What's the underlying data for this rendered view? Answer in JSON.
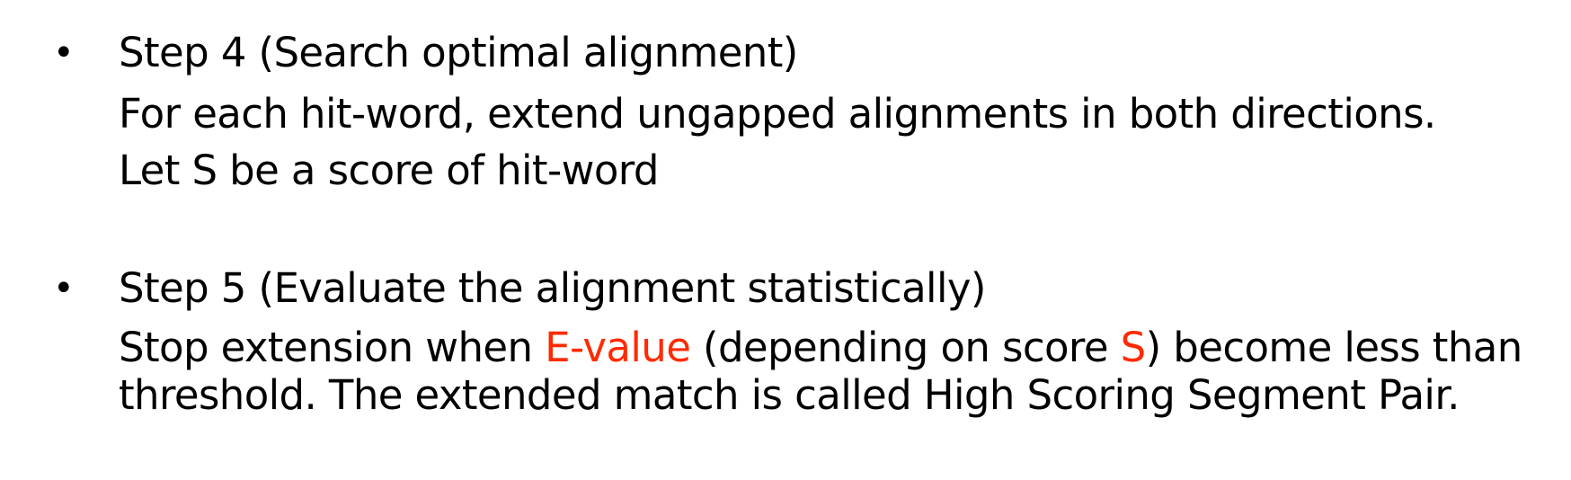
{
  "bullets": [
    {
      "symbol": "•",
      "heading": "Step 4 (Search optimal alignment)",
      "line2": "For each hit-word, extend ungapped alignments in both directions.",
      "line3": "Let S be a score of hit-word"
    },
    {
      "symbol": "•",
      "heading": "Step 5 (Evaluate the alignment statistically)",
      "line2_part1": "Stop extension when ",
      "line2_highlight1": "E-value",
      "line2_part2": " (depending on score ",
      "line2_highlight2": "S",
      "line2_part3": ") become less than",
      "line3": "threshold. The extended match is called High Scoring Segment Pair."
    }
  ],
  "colors": {
    "text": "#000000",
    "highlight": "#ff2a00",
    "background": "#ffffff"
  }
}
